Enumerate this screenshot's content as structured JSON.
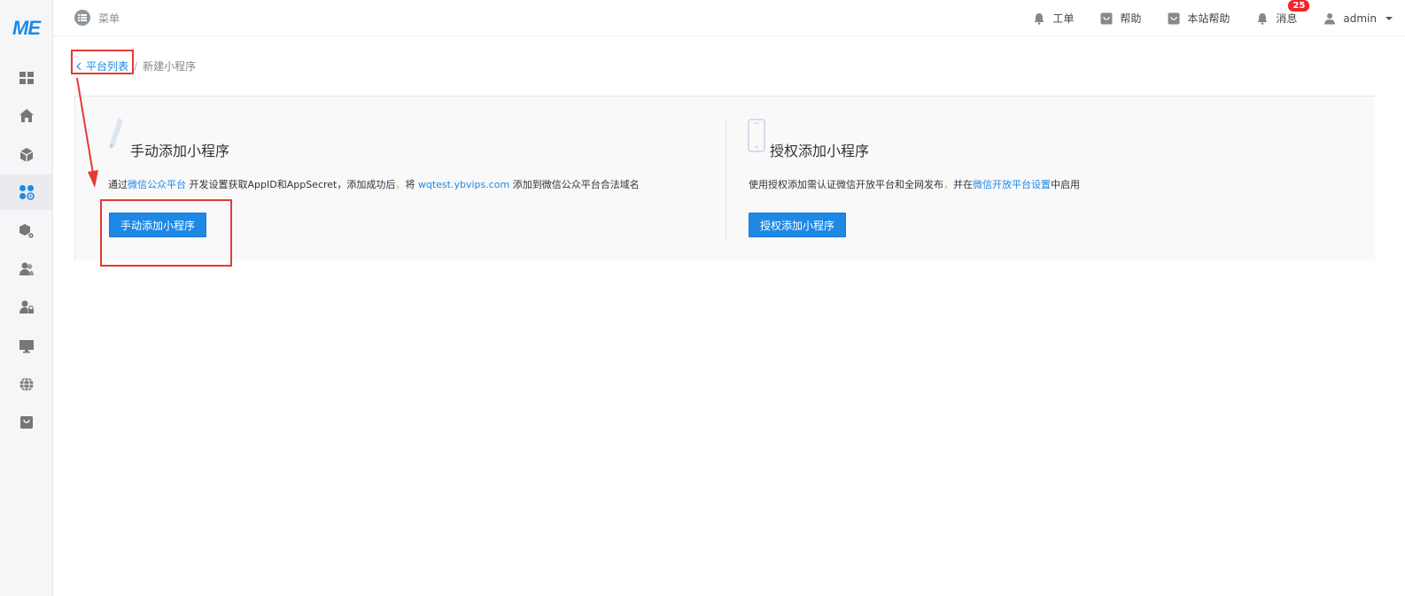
{
  "brand": {
    "logo_text": "ME",
    "accent_color": "#1e88e5"
  },
  "sidebar": {
    "items": [
      {
        "icon": "dashboard-icon"
      },
      {
        "icon": "home-icon"
      },
      {
        "icon": "cube-icon"
      },
      {
        "icon": "apps-settings-icon",
        "active": true
      },
      {
        "icon": "package-settings-icon"
      },
      {
        "icon": "users-icon"
      },
      {
        "icon": "user-lock-icon"
      },
      {
        "icon": "monitor-icon"
      },
      {
        "icon": "globe-icon"
      },
      {
        "icon": "store-icon"
      }
    ]
  },
  "topbar": {
    "menu_label": "菜单",
    "items": [
      {
        "label": "工单",
        "icon": "bell-icon"
      },
      {
        "label": "帮助",
        "icon": "help-box-icon"
      },
      {
        "label": "本站帮助",
        "icon": "help-box-icon"
      },
      {
        "label": "消息",
        "icon": "bell-icon",
        "badge": "25"
      }
    ],
    "user": {
      "name": "admin",
      "icon": "user-icon"
    }
  },
  "breadcrumb": {
    "back_label": "平台列表",
    "separator": "/",
    "current": "新建小程序"
  },
  "cards": {
    "manual": {
      "title": "手动添加小程序",
      "desc_prefix": "通过",
      "desc_link1": "微信公众平台",
      "desc_mid1": " 开发设置获取AppID和AppSecret，添加成功后",
      "desc_comma": "，",
      "desc_mid2": "将 ",
      "desc_domain": "wqtest.ybvips.com",
      "desc_suffix": " 添加到微信公众平台合法域名",
      "button_label": "手动添加小程序",
      "icon": "pencil-icon"
    },
    "auth": {
      "title": "授权添加小程序",
      "desc_prefix": "使用授权添加需认证微信开放平台和全网发布",
      "desc_comma": "，",
      "desc_mid": "并在",
      "desc_link": "微信开放平台设置",
      "desc_suffix": "中启用",
      "button_label": "授权添加小程序",
      "icon": "phone-icon"
    }
  }
}
